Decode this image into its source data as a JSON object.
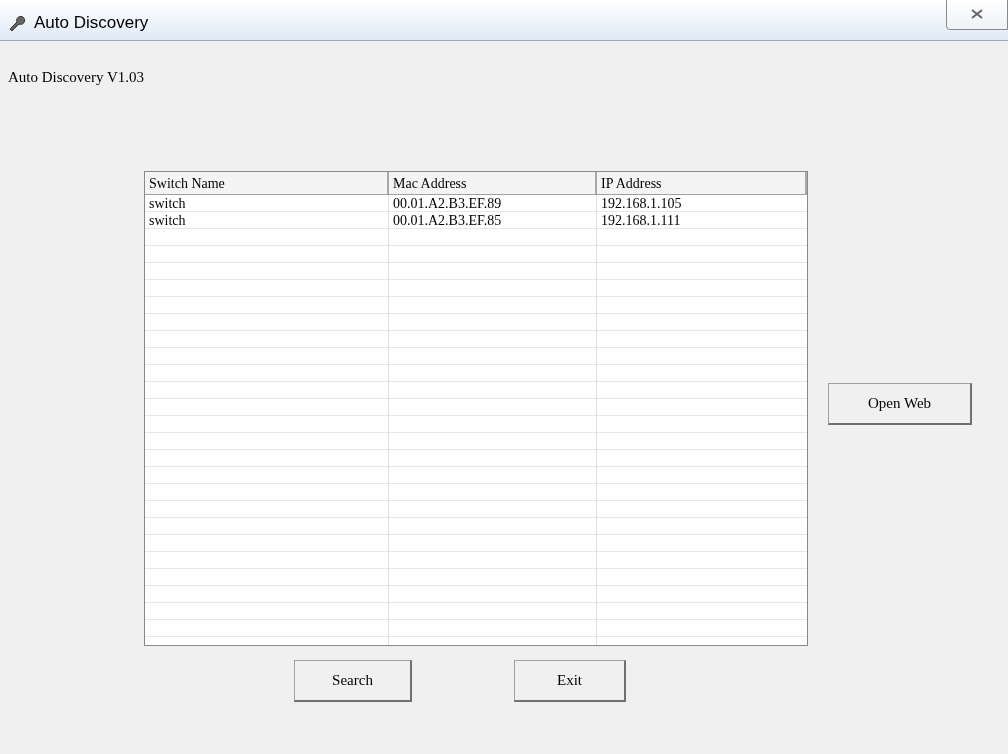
{
  "window": {
    "title": "Auto Discovery"
  },
  "version_label": "Auto Discovery V1.03",
  "table": {
    "columns": [
      "Switch Name",
      "Mac Address",
      "IP Address"
    ],
    "rows": [
      [
        "switch",
        "00.01.A2.B3.EF.89",
        "192.168.1.105"
      ],
      [
        "switch",
        "00.01.A2.B3.EF.85",
        "192.168.1.111"
      ]
    ]
  },
  "buttons": {
    "open_web": "Open Web",
    "search": "Search",
    "exit": "Exit"
  }
}
